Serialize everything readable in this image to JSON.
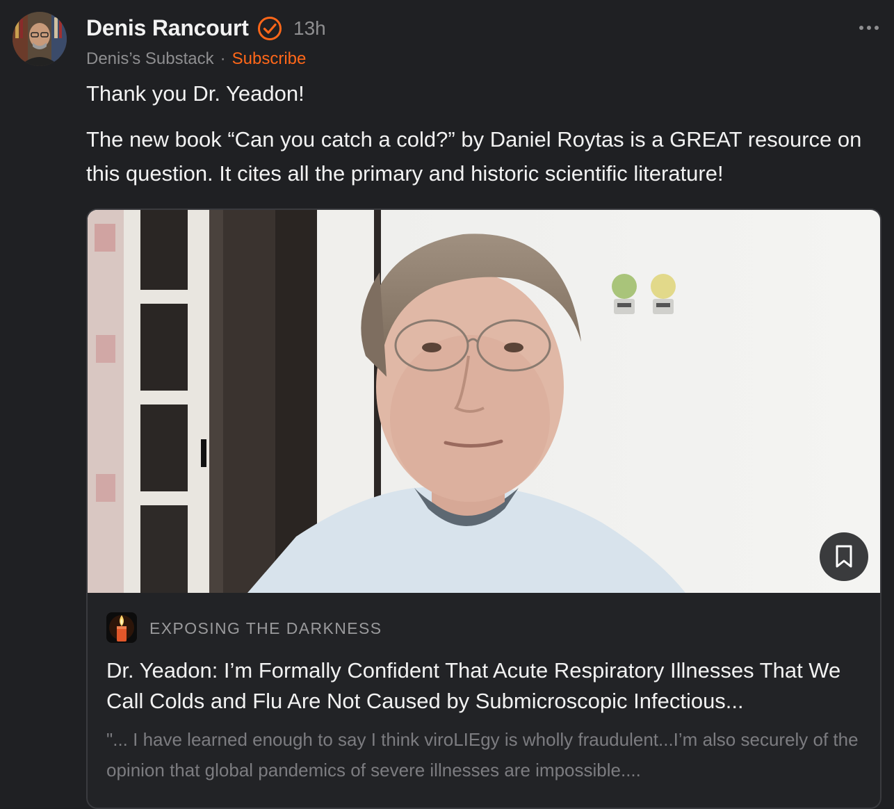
{
  "post": {
    "author_name": "Denis Rancourt",
    "time_ago": "13h",
    "publication_name": "Denis’s Substack",
    "separator": "·",
    "subscribe_label": "Subscribe",
    "paragraphs": [
      "Thank you Dr. Yeadon!",
      "The new book “Can you catch a cold?” by Daniel Roytas is a GREAT resource on this question. It cites all the primary and historic scientific literature!"
    ]
  },
  "embed": {
    "publication": "EXPOSING THE DARKNESS",
    "title": "Dr. Yeadon: I’m Formally Confident That Acute Respiratory Illnesses That We Call Colds and Flu Are Not Caused by Submicroscopic Infectious...",
    "excerpt": "\"... I have learned enough to say I think viroLIEgy is wholly fraudulent...I’m also securely of the opinion that global pandemics of severe illnesses are impossible...."
  },
  "icons": {
    "verified": "verified-check-icon",
    "more": "more-dots-icon",
    "bookmark": "bookmark-icon",
    "publication_logo": "candle-icon"
  },
  "colors": {
    "background": "#1f2023",
    "accent": "#ff6719",
    "text": "#f2f2f2",
    "muted": "#8e8e90"
  }
}
